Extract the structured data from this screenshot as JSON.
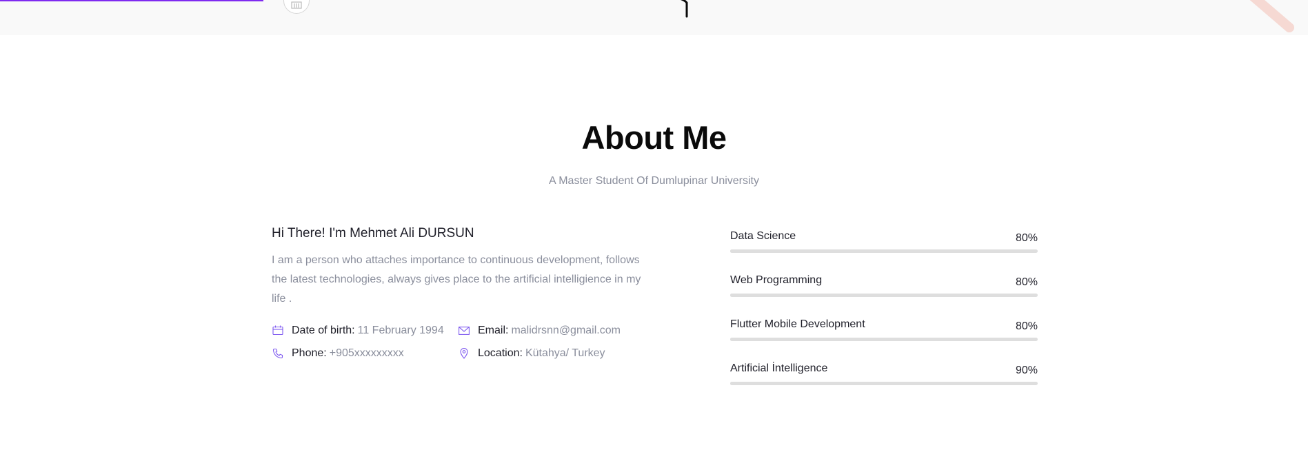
{
  "about": {
    "title": "About Me",
    "subtitle": "A Master Student Of Dumlupinar University",
    "intro_heading": "Hi There! I'm Mehmet Ali DURSUN",
    "intro_text": "I am a person who attaches importance to continuous development, follows the latest technologies, always gives place to the artificial intelligience in my life ."
  },
  "info": [
    {
      "icon": "calendar-icon",
      "label": "Date of birth:",
      "value": "11 February 1994"
    },
    {
      "icon": "envelope-icon",
      "label": "Email:",
      "value": "malidrsnn@gmail.com"
    },
    {
      "icon": "phone-icon",
      "label": "Phone:",
      "value": "+905xxxxxxxxx"
    },
    {
      "icon": "location-pin-icon",
      "label": "Location:",
      "value": "Kütahya/ Turkey"
    }
  ],
  "skills": [
    {
      "name": "Data Science",
      "percent_label": "80%",
      "percent": 80
    },
    {
      "name": "Web Programming",
      "percent_label": "80%",
      "percent": 80
    },
    {
      "name": "Flutter Mobile Development",
      "percent_label": "80%",
      "percent": 80
    },
    {
      "name": "Artificial İntelligence",
      "percent_label": "90%",
      "percent": 90
    }
  ],
  "colors": {
    "accent": "#7f2bf0",
    "text_dark": "#1e1e28",
    "text_muted": "#8a8e9c",
    "track": "#dedede",
    "top_strip": "#f9f9f9"
  }
}
